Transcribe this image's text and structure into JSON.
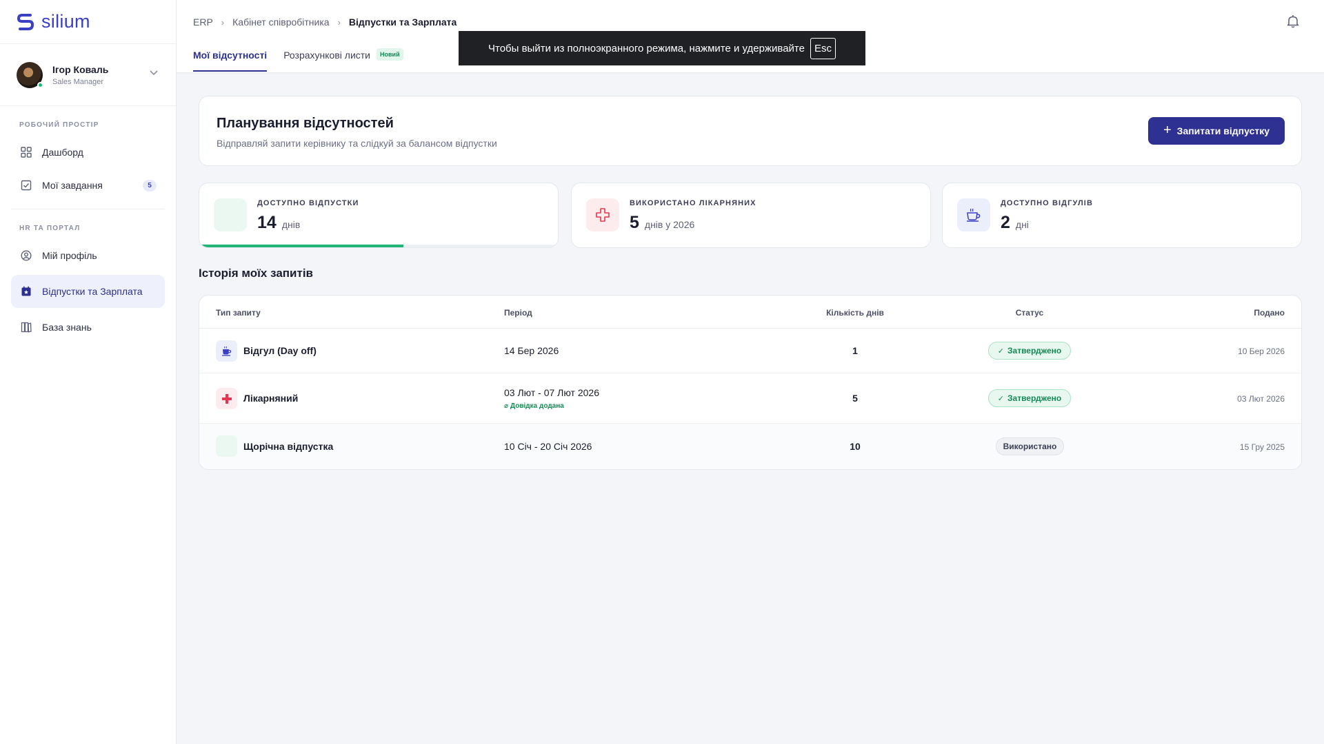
{
  "app": {
    "logo_text": "silium"
  },
  "user": {
    "name": "Ігор Коваль",
    "role": "Sales Manager"
  },
  "sidebar": {
    "section1_label": "РОБОЧИЙ ПРОСТІР",
    "section2_label": "HR ТА ПОРТАЛ",
    "items": [
      {
        "label": "Дашборд",
        "icon": "grid-icon"
      },
      {
        "label": "Мої завдання",
        "icon": "tasks-icon",
        "badge": "5"
      },
      {
        "label": "Мій профіль",
        "icon": "profile-icon"
      },
      {
        "label": "Відпустки та Зарплата",
        "icon": "calendar-star-icon",
        "active": true
      },
      {
        "label": "База знань",
        "icon": "book-icon"
      }
    ]
  },
  "header": {
    "breadcrumb": [
      "ERP",
      "Кабінет співробітника",
      "Відпустки та Зарплата"
    ],
    "tabs": [
      {
        "label": "Мої відсутності",
        "active": true
      },
      {
        "label": "Розрахункові листи",
        "badge": "Новий"
      }
    ]
  },
  "fullscreen_toast": {
    "text": "Чтобы выйти из полноэкранного режима, нажмите и удерживайте",
    "key": "Esc"
  },
  "planning": {
    "title": "Планування відсутностей",
    "subtitle": "Відправляй запити керівнику та слідкуй за балансом відпустки",
    "button_label": "Запитати відпустку"
  },
  "stats": [
    {
      "label": "ДОСТУПНО ВІДПУСТКИ",
      "value": "14",
      "unit": "днів",
      "progress": 0.57,
      "icon": "vacation-icon"
    },
    {
      "label": "ВИКОРИСТАНО ЛІКАРНЯНИХ",
      "value": "5",
      "unit": "днів у 2026",
      "icon": "medical-cross-icon"
    },
    {
      "label": "ДОСТУПНО ВІДГУЛІВ",
      "value": "2",
      "unit": "дні",
      "icon": "coffee-icon"
    }
  ],
  "history": {
    "title": "Історія моїх запитів",
    "columns": [
      "Тип запиту",
      "Період",
      "Кількість днів",
      "Статус",
      "Подано"
    ],
    "rows": [
      {
        "type": "Відгул (Day off)",
        "icon": "coffee-icon",
        "period": "14 Бер 2026",
        "days": "1",
        "status": "Затверджено",
        "submitted": "10 Бер 2026"
      },
      {
        "type": "Лікарняний",
        "icon": "medical-cross-icon",
        "period": "03 Лют - 07 Лют 2026",
        "note": "Довідка додана",
        "days": "5",
        "status": "Затверджено",
        "submitted": "03 Лют 2026"
      },
      {
        "type": "Щорічна відпустка",
        "icon": "vacation-icon",
        "period": "10 Січ - 20 Січ 2026",
        "days": "10",
        "status": "Використано",
        "submitted": "15 Гру 2025"
      }
    ]
  },
  "colors": {
    "primary": "#2e3192",
    "success": "#22b573",
    "danger": "#e5354f"
  }
}
